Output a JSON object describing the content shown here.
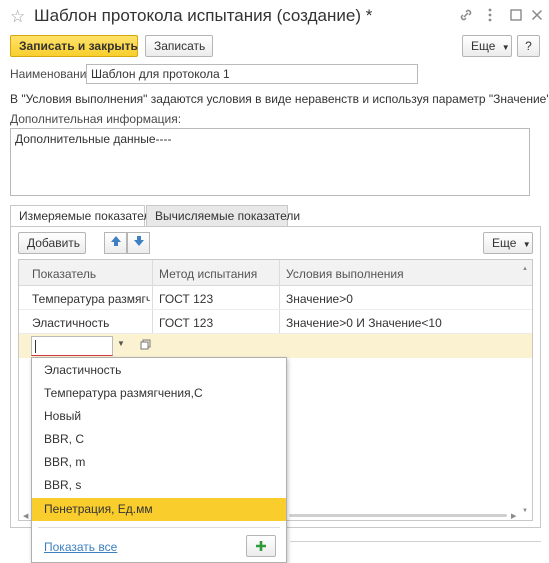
{
  "window": {
    "title": "Шаблон протокола испытания (создание) *",
    "icons": [
      "star-icon",
      "link-icon",
      "more-vertical-icon",
      "maximize-icon",
      "close-icon"
    ]
  },
  "toolbar": {
    "save_close_label": "Записать и закрыть",
    "save_label": "Записать",
    "more_label": "Еще",
    "help_label": "?"
  },
  "form": {
    "name_label": "Наименование:",
    "name_value": "Шаблон для протокола 1",
    "hint": "В \"Условия выполнения\"  задаются условия в виде неравенств и используя параметр \"Значение\"",
    "additional_label": "Дополнительная информация:",
    "additional_value": "Дополнительные данные----"
  },
  "tabs": [
    {
      "label": "Измеряемые показатели",
      "active": true
    },
    {
      "label": "Вычисляемые показатели",
      "active": false
    }
  ],
  "table_toolbar": {
    "add_label": "Добавить",
    "more_label": "Еще"
  },
  "table": {
    "columns": [
      "Показатель",
      "Метод испытания",
      "Условия выполнения"
    ],
    "rows": [
      [
        "Температура размягч...",
        "ГОСТ 123",
        "Значение>0"
      ],
      [
        "Эластичность",
        "ГОСТ 123",
        "Значение>0 И Значение<10"
      ]
    ]
  },
  "dropdown": {
    "items": [
      "Эластичность",
      "Температура размягчения,С",
      "Новый",
      "BBR, C",
      "BBR, m",
      "BBR, s",
      "Пенетрация, Ед.мм"
    ],
    "selected_index": 6,
    "show_all_label": "Показать все",
    "add_icon": "plus-icon"
  },
  "colors": {
    "accent": "#f9cd2c",
    "edit_row": "#fbf2d2",
    "link": "#3d7fc1",
    "add_icon": "#2e9a3a"
  }
}
